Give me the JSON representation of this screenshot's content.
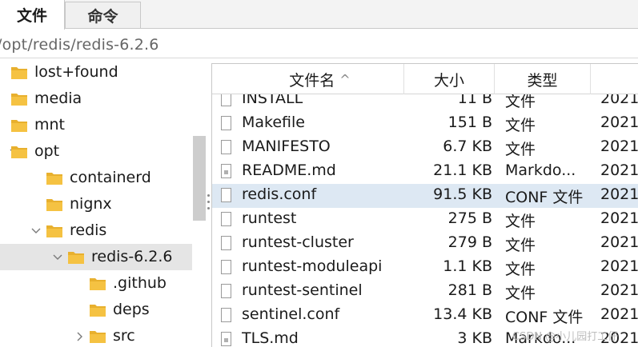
{
  "tabs": [
    {
      "label": "文件",
      "active": true
    },
    {
      "label": "命令",
      "active": false
    }
  ],
  "path": "/opt/redis/redis-6.2.6",
  "tree": [
    {
      "label": "lost+found",
      "expander": "none",
      "selected": false
    },
    {
      "label": "media",
      "expander": "none",
      "selected": false
    },
    {
      "label": "mnt",
      "expander": "none",
      "selected": false
    },
    {
      "label": "opt",
      "expander": "expanded",
      "selected": false
    },
    {
      "label": "containerd",
      "expander": "none",
      "selected": false
    },
    {
      "label": "nignx",
      "expander": "none",
      "selected": false
    },
    {
      "label": "redis",
      "expander": "expanded",
      "selected": false
    },
    {
      "label": "redis-6.2.6",
      "expander": "expanded",
      "selected": true
    },
    {
      "label": ".github",
      "expander": "none",
      "selected": false
    },
    {
      "label": "deps",
      "expander": "none",
      "selected": false
    },
    {
      "label": "src",
      "expander": "collapsed",
      "selected": false
    }
  ],
  "columns": {
    "name": "文件名",
    "size": "大小",
    "type": "类型",
    "sort_indicator": "^"
  },
  "files": [
    {
      "name": "INSTALL",
      "size": "11 B",
      "type": "文件",
      "date": "2021",
      "icon": "file-icon",
      "selected": false
    },
    {
      "name": "Makefile",
      "size": "151 B",
      "type": "文件",
      "date": "2021",
      "icon": "file-icon",
      "selected": false
    },
    {
      "name": "MANIFESTO",
      "size": "6.7 KB",
      "type": "文件",
      "date": "2021",
      "icon": "file-icon",
      "selected": false
    },
    {
      "name": "README.md",
      "size": "21.1 KB",
      "type": "Markdo...",
      "date": "2021",
      "icon": "markdown-file-icon",
      "selected": false
    },
    {
      "name": "redis.conf",
      "size": "91.5 KB",
      "type": "CONF 文件",
      "date": "2021",
      "icon": "file-icon",
      "selected": true
    },
    {
      "name": "runtest",
      "size": "275 B",
      "type": "文件",
      "date": "2021",
      "icon": "file-icon",
      "selected": false
    },
    {
      "name": "runtest-cluster",
      "size": "279 B",
      "type": "文件",
      "date": "2021",
      "icon": "file-icon",
      "selected": false
    },
    {
      "name": "runtest-moduleapi",
      "size": "1.1 KB",
      "type": "文件",
      "date": "2021",
      "icon": "file-icon",
      "selected": false
    },
    {
      "name": "runtest-sentinel",
      "size": "281 B",
      "type": "文件",
      "date": "2021",
      "icon": "file-icon",
      "selected": false
    },
    {
      "name": "sentinel.conf",
      "size": "13.4 KB",
      "type": "CONF 文件",
      "date": "2021",
      "icon": "file-icon",
      "selected": false
    },
    {
      "name": "TLS.md",
      "size": "3 KB",
      "type": "Markdo...",
      "date": "2021",
      "icon": "markdown-file-icon",
      "selected": false
    }
  ],
  "watermark": "CSDN @小儿园打工仔",
  "colors": {
    "folder": "#f5c242",
    "selected_tree": "#e5e5e5",
    "selected_file": "#dde8f3"
  }
}
